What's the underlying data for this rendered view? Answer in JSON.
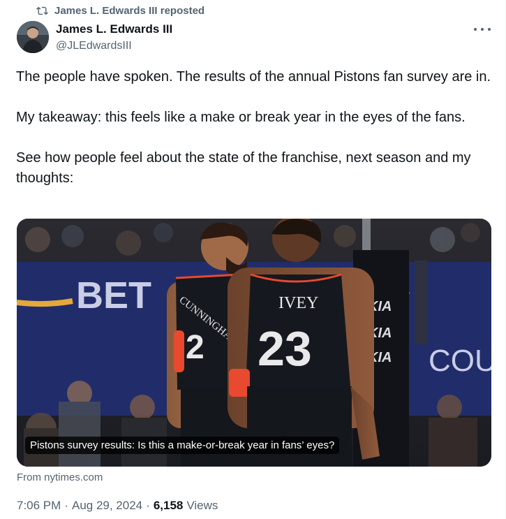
{
  "repost": {
    "label": "James L. Edwards III reposted",
    "icon": "repost-icon"
  },
  "author": {
    "name": "James L. Edwards III",
    "handle": "@JLEdwardsIII"
  },
  "tweet": {
    "paragraphs": [
      "The people have spoken. The results of the annual Pistons fan survey are in.",
      "My takeaway: this feels like a make or break year in the eyes of the fans.",
      "See how people feel about the state of the franchise, next season and my thoughts:"
    ]
  },
  "card": {
    "caption": "Pistons survey results: Is this a make-or-break year in fans’ eyes?",
    "image_text": {
      "sponsor_left": "BET",
      "sponsor_right": "COU",
      "kia": "KIA",
      "player1_name": "CUNNINGHAM",
      "player1_number": "2",
      "player2_name": "IVEY",
      "player2_number": "23"
    }
  },
  "source": "From nytimes.com",
  "meta": {
    "time": "7:06 PM",
    "sep": "·",
    "date": "Aug 29, 2024",
    "views_count": "6,158",
    "views_label": "Views"
  },
  "colors": {
    "muted": "#536471",
    "text": "#0f1419",
    "jersey": "#15181e",
    "accent": "#e8492f"
  }
}
